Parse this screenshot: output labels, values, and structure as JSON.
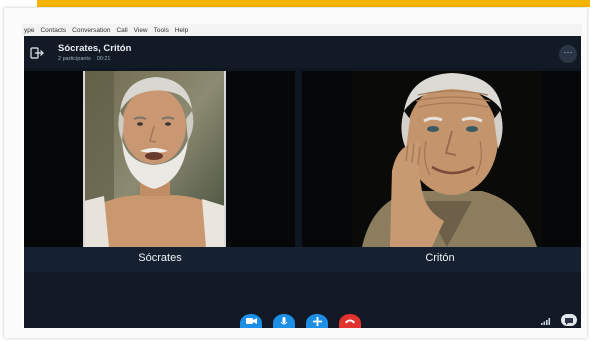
{
  "menubar": {
    "items": [
      {
        "label": "ype"
      },
      {
        "label": "Contacts"
      },
      {
        "label": "Conversation"
      },
      {
        "label": "Call"
      },
      {
        "label": "View"
      },
      {
        "label": "Tools"
      },
      {
        "label": "Help"
      }
    ]
  },
  "call": {
    "title": "Sócrates, Critón",
    "participants": "2 participants",
    "duration": "00:21",
    "more_label": "···"
  },
  "participants": [
    {
      "name": "Sócrates"
    },
    {
      "name": "Critón"
    }
  ],
  "controls": [
    "video-icon",
    "mic-icon",
    "add-icon",
    "end-call-icon"
  ],
  "colors": {
    "accent": "#f4b400",
    "call_bg": "#0e1621",
    "control_blue": "#1d8ee6",
    "end_call_red": "#e0322f"
  }
}
